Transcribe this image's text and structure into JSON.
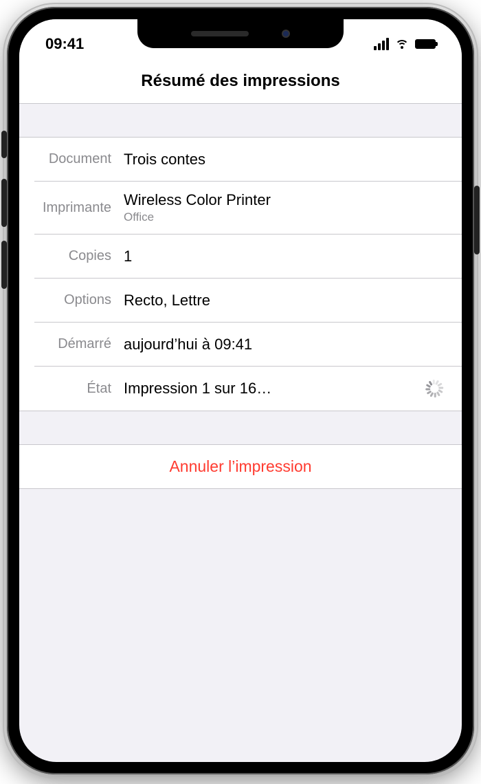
{
  "statusbar": {
    "time": "09:41"
  },
  "navbar": {
    "title": "Résumé des impressions"
  },
  "rows": {
    "document": {
      "label": "Document",
      "value": "Trois contes"
    },
    "printer": {
      "label": "Imprimante",
      "value": "Wireless Color Printer",
      "location": "Office"
    },
    "copies": {
      "label": "Copies",
      "value": "1"
    },
    "options": {
      "label": "Options",
      "value": "Recto, Lettre"
    },
    "started": {
      "label": "Démarré",
      "value": "aujourd’hui à 09:41"
    },
    "status": {
      "label": "État",
      "value": "Impression 1 sur 16…"
    }
  },
  "actions": {
    "cancel": "Annuler l’impression"
  }
}
